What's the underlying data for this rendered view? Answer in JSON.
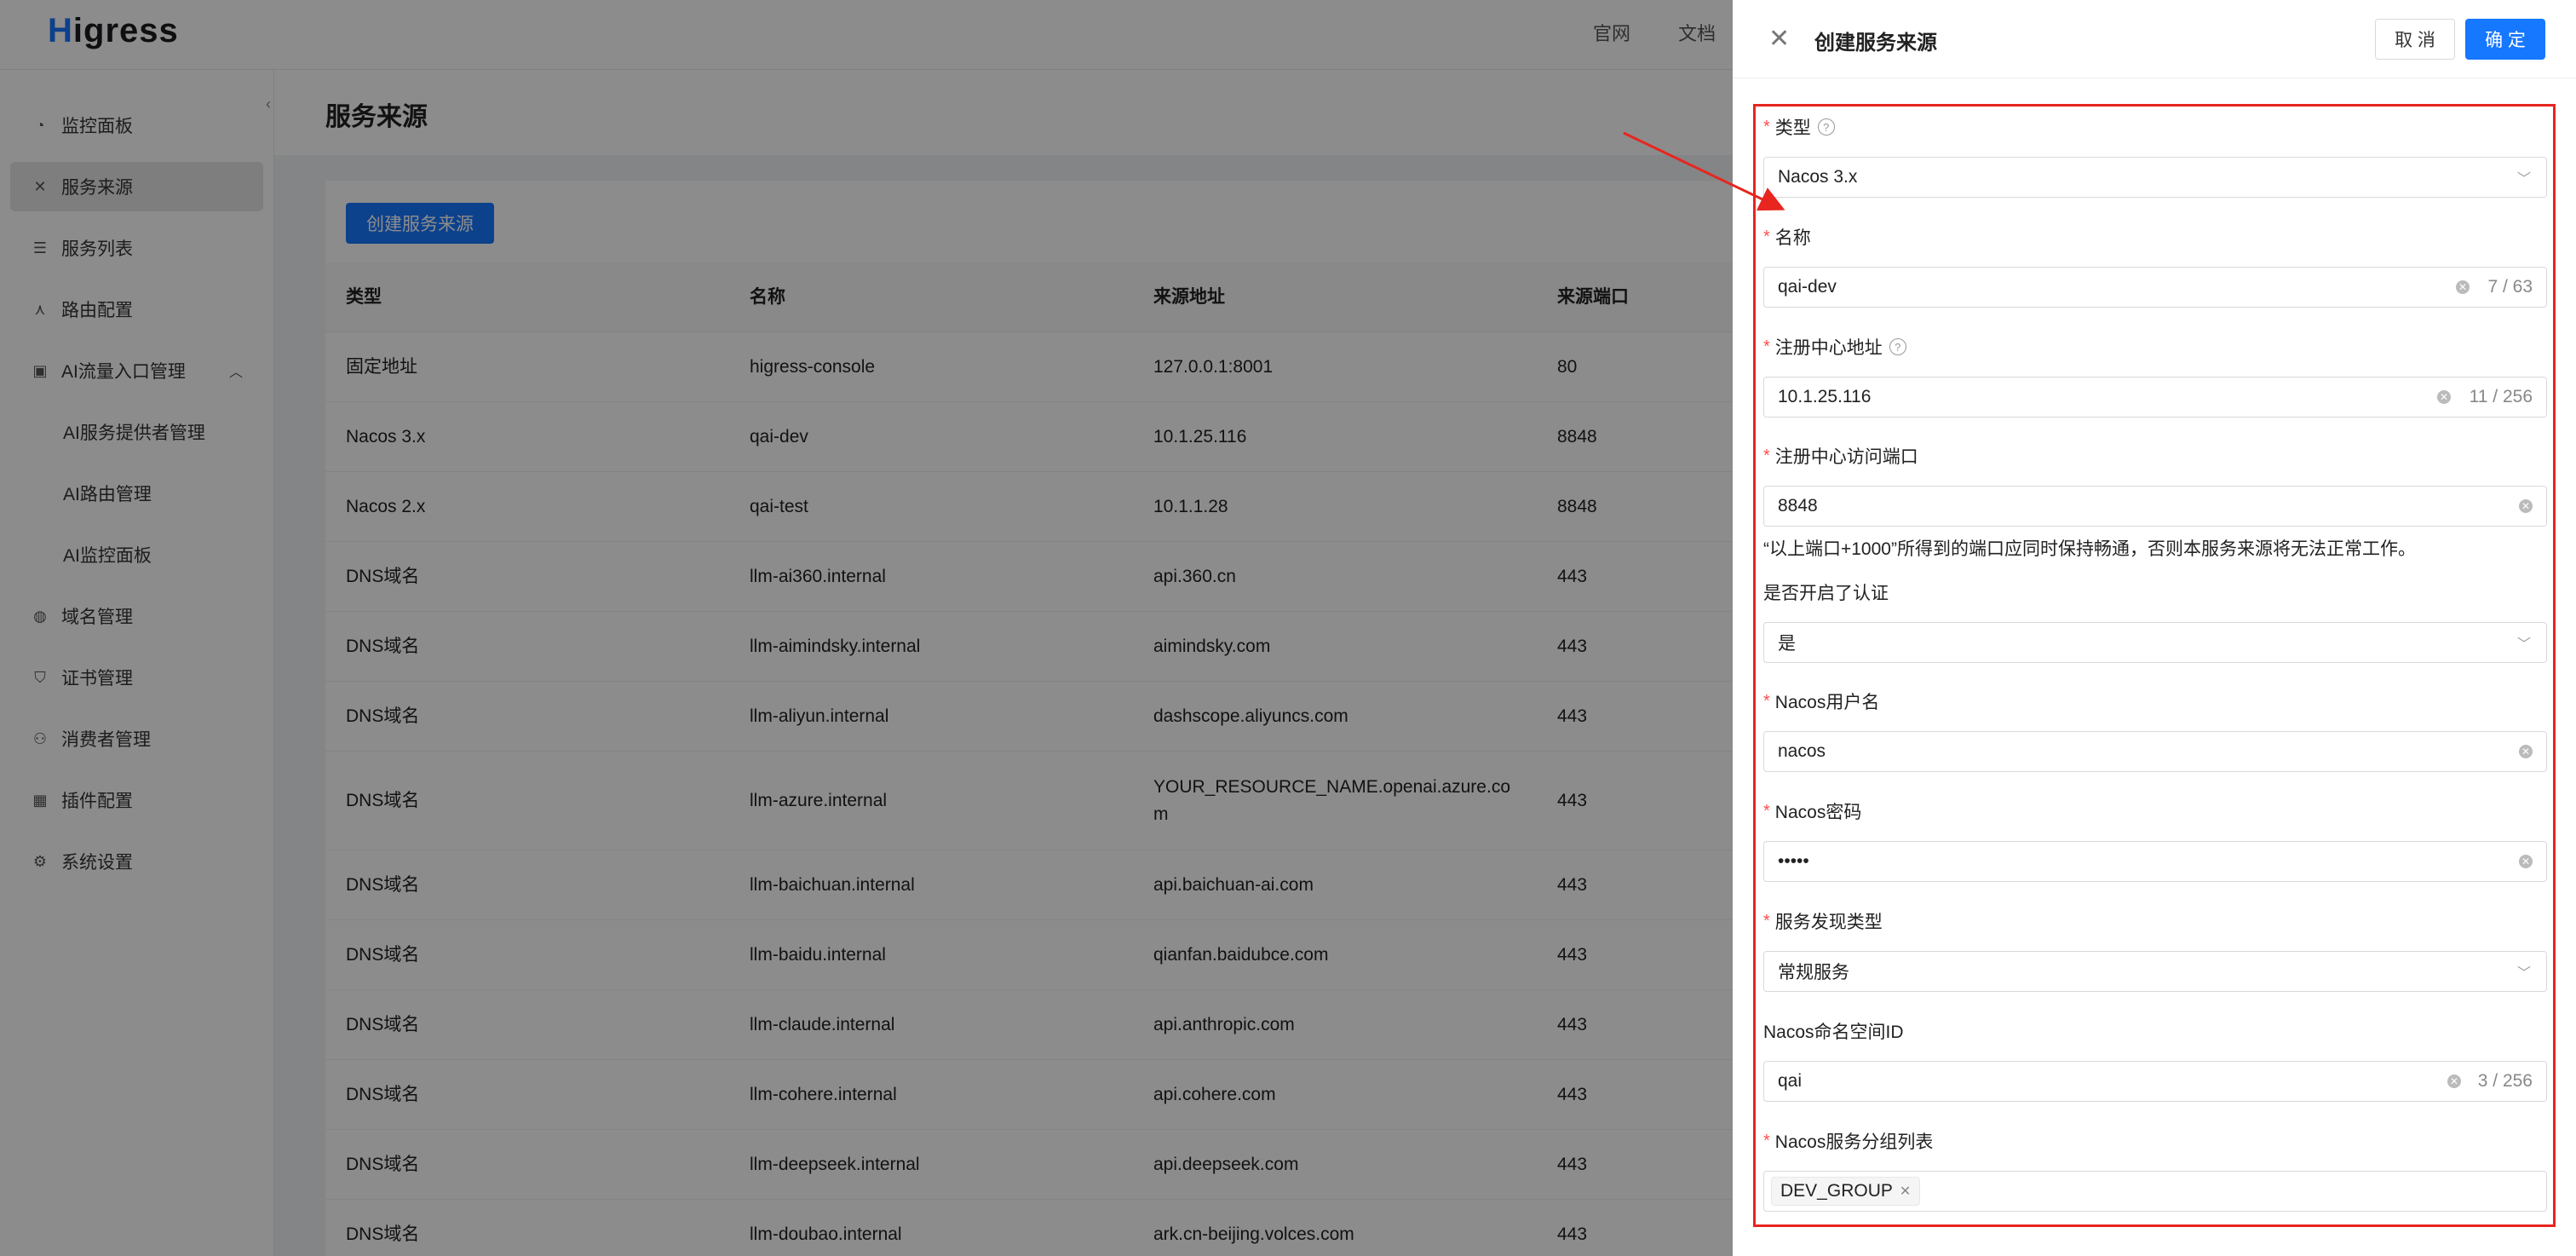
{
  "header": {
    "logo_prefix": "H",
    "logo_rest": "igress",
    "links": [
      "官网",
      "文档"
    ]
  },
  "sidebar": {
    "items": [
      {
        "label": "监控面板",
        "icon": "dashboard-icon"
      },
      {
        "label": "服务来源",
        "icon": "service-source-icon",
        "active": true
      },
      {
        "label": "服务列表",
        "icon": "list-icon"
      },
      {
        "label": "路由配置",
        "icon": "route-icon"
      },
      {
        "label": "AI流量入口管理",
        "icon": "ai-gateway-icon",
        "expanded": true
      },
      {
        "label": "AI服务提供者管理",
        "sub": true
      },
      {
        "label": "AI路由管理",
        "sub": true
      },
      {
        "label": "AI监控面板",
        "sub": true
      },
      {
        "label": "域名管理",
        "icon": "globe-icon"
      },
      {
        "label": "证书管理",
        "icon": "shield-icon"
      },
      {
        "label": "消费者管理",
        "icon": "user-icon"
      },
      {
        "label": "插件配置",
        "icon": "plugin-icon"
      },
      {
        "label": "系统设置",
        "icon": "gear-icon"
      }
    ]
  },
  "main": {
    "title": "服务来源",
    "create_button": "创建服务来源",
    "columns": [
      "类型",
      "名称",
      "来源地址",
      "来源端口"
    ],
    "rows": [
      [
        "固定地址",
        "higress-console",
        "127.0.0.1:8001",
        "80"
      ],
      [
        "Nacos 3.x",
        "qai-dev",
        "10.1.25.116",
        "8848"
      ],
      [
        "Nacos 2.x",
        "qai-test",
        "10.1.1.28",
        "8848"
      ],
      [
        "DNS域名",
        "llm-ai360.internal",
        "api.360.cn",
        "443"
      ],
      [
        "DNS域名",
        "llm-aimindsky.internal",
        "aimindsky.com",
        "443"
      ],
      [
        "DNS域名",
        "llm-aliyun.internal",
        "dashscope.aliyuncs.com",
        "443"
      ],
      [
        "DNS域名",
        "llm-azure.internal",
        "YOUR_RESOURCE_NAME.openai.azure.com",
        "443"
      ],
      [
        "DNS域名",
        "llm-baichuan.internal",
        "api.baichuan-ai.com",
        "443"
      ],
      [
        "DNS域名",
        "llm-baidu.internal",
        "qianfan.baidubce.com",
        "443"
      ],
      [
        "DNS域名",
        "llm-claude.internal",
        "api.anthropic.com",
        "443"
      ],
      [
        "DNS域名",
        "llm-cohere.internal",
        "api.cohere.com",
        "443"
      ],
      [
        "DNS域名",
        "llm-deepseek.internal",
        "api.deepseek.com",
        "443"
      ],
      [
        "DNS域名",
        "llm-doubao.internal",
        "ark.cn-beijing.volces.com",
        "443"
      ]
    ]
  },
  "drawer": {
    "title": "创建服务来源",
    "cancel": "取 消",
    "ok": "确 定",
    "fields": {
      "type": {
        "label": "类型",
        "value": "Nacos 3.x"
      },
      "name": {
        "label": "名称",
        "value": "qai-dev",
        "count": "7 / 63"
      },
      "registry": {
        "label": "注册中心地址",
        "value": "10.1.25.116",
        "count": "11 / 256"
      },
      "port": {
        "label": "注册中心访问端口",
        "value": "8848",
        "hint": "“以上端口+1000”所得到的端口应同时保持畅通，否则本服务来源将无法正常工作。"
      },
      "auth": {
        "label": "是否开启了认证",
        "value": "是"
      },
      "username": {
        "label": "Nacos用户名",
        "value": "nacos"
      },
      "password": {
        "label": "Nacos密码",
        "value": "•••••"
      },
      "discovery": {
        "label": "服务发现类型",
        "value": "常规服务"
      },
      "namespace": {
        "label": "Nacos命名空间ID",
        "value": "qai",
        "count": "3 / 256"
      },
      "groups": {
        "label": "Nacos服务分组列表",
        "tags": [
          "DEV_GROUP"
        ]
      }
    }
  },
  "colors": {
    "primary": "#1677ff",
    "annotation": "#e8251f",
    "required": "#ff4d4f"
  }
}
